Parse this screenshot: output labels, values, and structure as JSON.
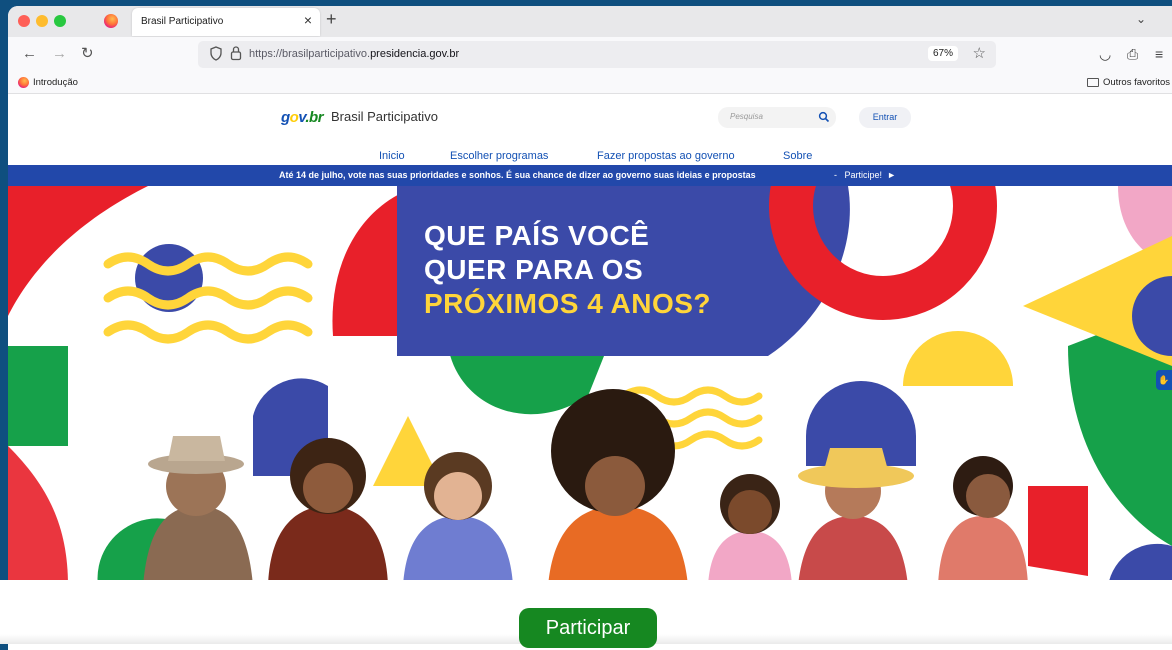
{
  "browser": {
    "tab_title": "Brasil Participativo",
    "url_host": "https://brasilparticipativo.",
    "url_domain": "presidencia.gov.br",
    "zoom": "67%",
    "bookmark_intro": "Introdução",
    "bookmark_others": "Outros favoritos"
  },
  "site": {
    "logo_g": "g",
    "logo_o": "o",
    "logo_v": "v",
    "logo_br": ".br",
    "name": "Brasil Participativo",
    "search_placeholder": "Pesquisa",
    "login_label": "Entrar",
    "menu": [
      {
        "label": "Inicio"
      },
      {
        "label": "Escolher programas"
      },
      {
        "label": "Fazer propostas ao governo"
      },
      {
        "label": "Sobre"
      }
    ],
    "announcement": "Até 14 de julho, vote nas suas prioridades e sonhos. É sua chance de dizer ao governo suas ideias e propostas",
    "announcement_separator": "-",
    "announcement_link": "Participe!",
    "announcement_arrow": "►"
  },
  "hero": {
    "headline_line1": "QUE PAÍS VOCÊ",
    "headline_line2": "QUER PARA OS",
    "headline_line3": "PRÓXIMOS 4 ANOS?",
    "colors": {
      "blue": "#3b4aa8",
      "red": "#e8202a",
      "green": "#16a14a",
      "yellow": "#ffd53a",
      "pink": "#f2a7c6"
    }
  },
  "cta_label": "Participar",
  "icons": {
    "back": "←",
    "forward": "→",
    "reload": "↻",
    "star": "☆",
    "close": "×",
    "new_tab": "+",
    "tab_list": "⌄",
    "menu": "≡",
    "pocket": "◡",
    "share": "⎙",
    "vlibras": "✋"
  }
}
